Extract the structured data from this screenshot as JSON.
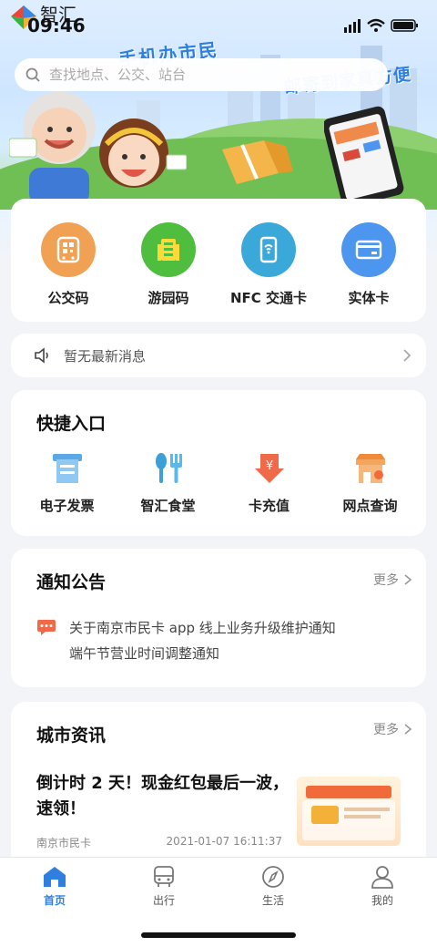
{
  "status_bar": {
    "time": "09:46",
    "logo_text": "智汇"
  },
  "banner": {
    "slogan_line1": "手机办市民",
    "slogan_line2": "邮寄到家真方便"
  },
  "search": {
    "placeholder": "查找地点、公交、站台"
  },
  "top_services": [
    {
      "label": "公交码",
      "icon": "bus-qr-icon",
      "color": "#f0a154"
    },
    {
      "label": "游园码",
      "icon": "park-gate-icon",
      "color": "#4fbe3f"
    },
    {
      "label": "NFC 交通卡",
      "icon": "nfc-phone-icon",
      "color": "#3aa8d8"
    },
    {
      "label": "实体卡",
      "icon": "card-icon",
      "color": "#4d96f0"
    }
  ],
  "news_bar": {
    "text": "暂无最新消息"
  },
  "quick_entry": {
    "title": "快捷入口",
    "items": [
      {
        "label": "电子发票",
        "icon": "invoice-icon"
      },
      {
        "label": "智汇食堂",
        "icon": "canteen-icon"
      },
      {
        "label": "卡充值",
        "icon": "recharge-icon"
      },
      {
        "label": "网点查询",
        "icon": "outlet-icon"
      }
    ]
  },
  "notices": {
    "title": "通知公告",
    "more_label": "更多",
    "items": [
      "关于南京市民卡 app 线上业务升级维护通知",
      "端午节营业时间调整通知"
    ]
  },
  "city_news": {
    "title": "城市资讯",
    "more_label": "更多",
    "article": {
      "title": "倒计时 2 天！现金红包最后一波，速领！",
      "source": "南京市民卡",
      "datetime": "2021-01-07 16:11:37"
    }
  },
  "tab_bar": {
    "active_color": "#2f7fe0",
    "items": [
      {
        "label": "首页",
        "icon": "home-icon",
        "active": true
      },
      {
        "label": "出行",
        "icon": "bus-icon",
        "active": false
      },
      {
        "label": "生活",
        "icon": "compass-icon",
        "active": false
      },
      {
        "label": "我的",
        "icon": "person-icon",
        "active": false
      }
    ]
  }
}
